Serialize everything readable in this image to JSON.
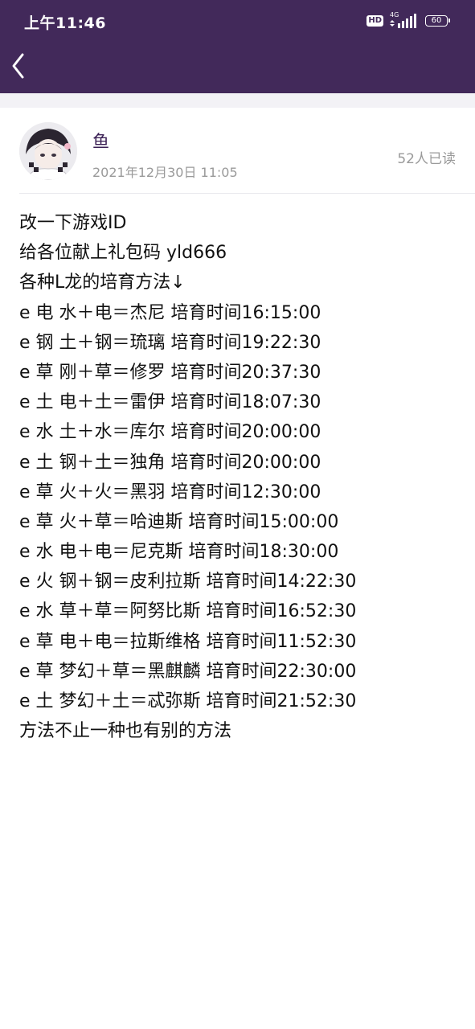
{
  "status_bar": {
    "time": "上午11:46",
    "hd_badge": "HD",
    "network": "4G",
    "battery": "60"
  },
  "nav": {
    "back_icon": "chevron-left-icon"
  },
  "post": {
    "author": "鱼",
    "date": "2021年12月30日 11:05",
    "read_count": "52人已读",
    "lines": [
      "改一下游戏ID",
      "给各位献上礼包码 yld666",
      "各种L龙的培育方法↓",
      "e 电 水＋电＝杰尼 培育时间16:15:00",
      "e 钢 土＋钢＝琉璃 培育时间19:22:30",
      "e 草 刚＋草＝修罗 培育时间20:37:30",
      "e 土 电＋土＝雷伊 培育时间18:07:30",
      "e 水 土＋水＝库尔 培育时间20:00:00",
      "e 土 钢＋土＝独角 培育时间20:00:00",
      "e 草 火＋火＝黑羽 培育时间12:30:00",
      "e 草 火＋草＝哈迪斯 培育时间15:00:00",
      "e 水 电＋电＝尼克斯 培育时间18:30:00",
      "e 火 钢＋钢＝皮利拉斯 培育时间14:22:30",
      "e 水 草＋草＝阿努比斯 培育时间16:52:30",
      "e 草 电＋电＝拉斯维格 培育时间11:52:30",
      "e 草 梦幻＋草＝黑麒麟 培育时间22:30:00",
      "e 土 梦幻＋土＝忒弥斯 培育时间21:52:30",
      "方法不止一种也有别的方法"
    ]
  },
  "colors": {
    "header_bg": "#42295a",
    "author_name": "#3a1f54",
    "meta_text": "#9a9a9a",
    "gap_strip": "#f3f2f6"
  }
}
